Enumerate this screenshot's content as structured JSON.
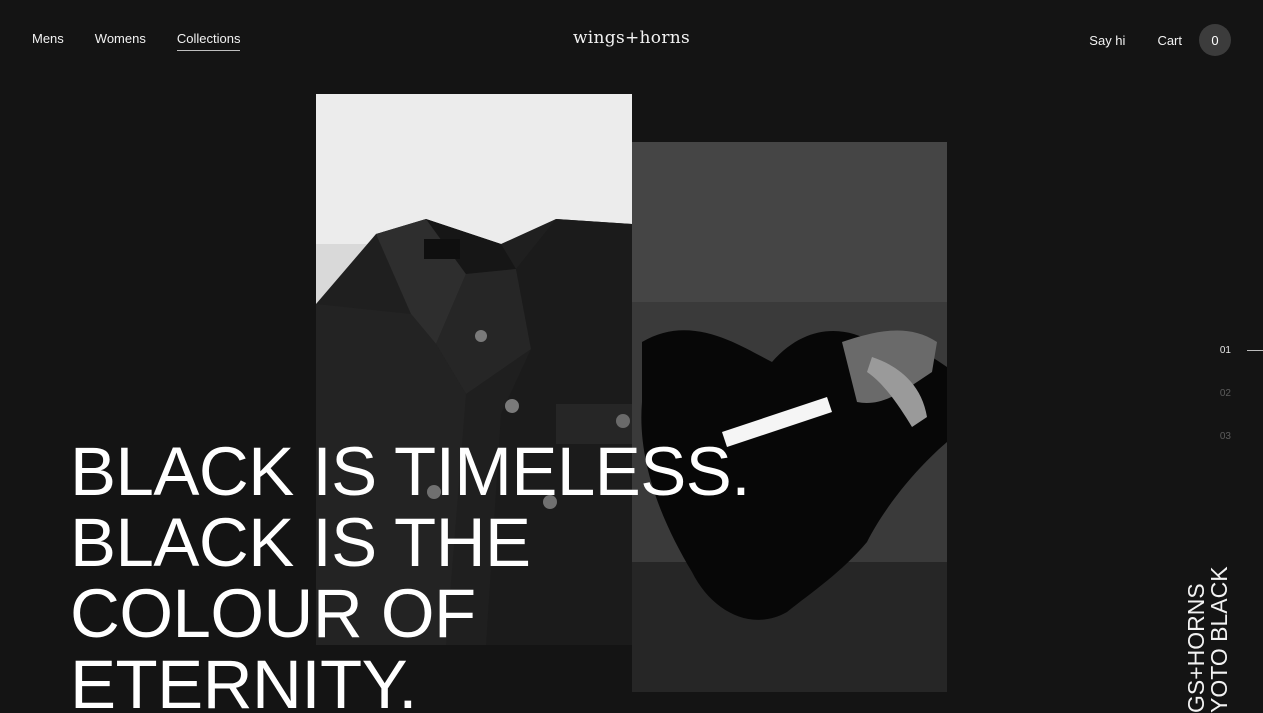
{
  "nav": {
    "links": [
      {
        "label": "Mens"
      },
      {
        "label": "Womens"
      },
      {
        "label": "Collections"
      }
    ]
  },
  "logo": {
    "text": "wings+horns"
  },
  "header_right": {
    "say_hi": "Say hi",
    "cart_label": "Cart",
    "cart_count": "0"
  },
  "hero": {
    "headline": "BLACK IS TIMELESS. BLACK IS THE COLOUR OF ETERNITY."
  },
  "slides": {
    "items": [
      "01",
      "02",
      "03"
    ],
    "active_index": 0
  },
  "vertical_label": {
    "line1": "GS+HORNS",
    "line2": "YOTO BLACK"
  },
  "colors": {
    "background": "#141414",
    "text": "#ffffff",
    "cart_badge": "#3c3c3c",
    "inactive_number": "#5c5c5c"
  }
}
